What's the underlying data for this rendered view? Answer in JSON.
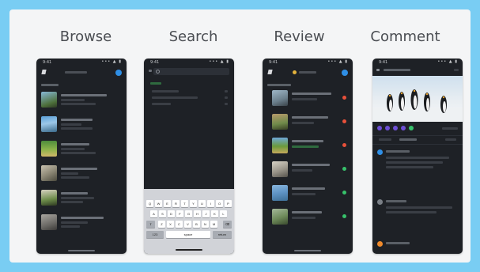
{
  "panels": [
    {
      "title": "Browse"
    },
    {
      "title": "Search"
    },
    {
      "title": "Review"
    },
    {
      "title": "Comment"
    }
  ],
  "status": {
    "time": "9:41",
    "icons": "••• ▲ ▮"
  },
  "colors": {
    "background": "#79cdf3",
    "card": "#f4f5f6",
    "phone": "#1e2126",
    "accent_blue": "#2f8fe6",
    "status_red": "#e8503a",
    "status_green": "#37c26b",
    "status_orange": "#f08a2b"
  },
  "keyboard": {
    "row1": [
      "Q",
      "W",
      "E",
      "R",
      "T",
      "Y",
      "U",
      "I",
      "O",
      "P"
    ],
    "row2": [
      "A",
      "S",
      "D",
      "F",
      "G",
      "H",
      "J",
      "K",
      "L"
    ],
    "row3": [
      "Z",
      "X",
      "C",
      "V",
      "B",
      "N",
      "M"
    ],
    "space_label": "space",
    "return_label": "return",
    "num_label": "123",
    "shift_label": "⇧",
    "delete_label": "⌫"
  },
  "icons": {
    "logo": "app-logo-icon",
    "avatar": "avatar-icon",
    "search": "search-icon"
  }
}
